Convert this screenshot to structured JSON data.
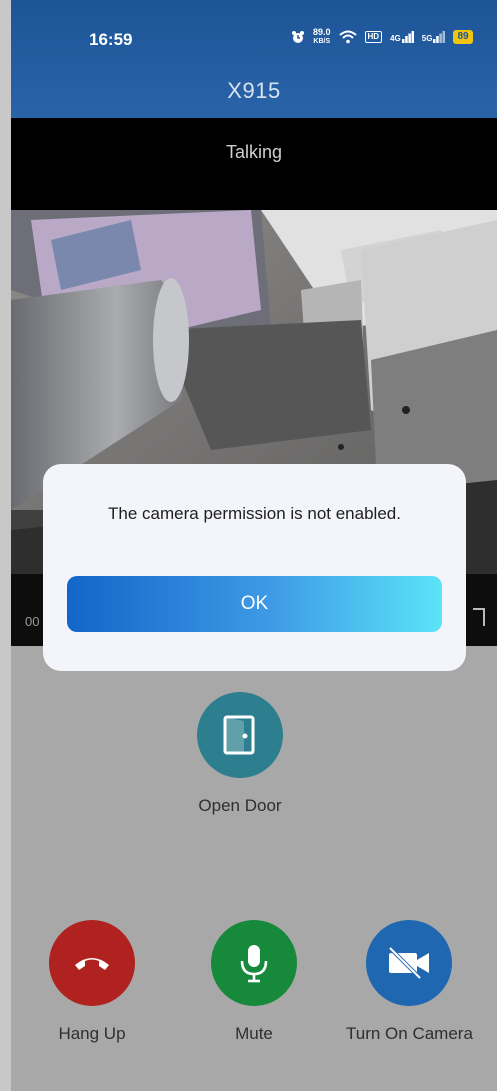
{
  "status_bar": {
    "time": "16:59",
    "speed_value": "89.0",
    "speed_unit": "KB/S",
    "hd_label": "HD",
    "net1": "4G",
    "net2": "5G",
    "battery": "89",
    "icons": [
      "alarm-icon",
      "wifi-icon",
      "signal-icon",
      "battery-icon"
    ]
  },
  "header": {
    "title": "X915"
  },
  "call": {
    "status": "Talking",
    "timer": "00"
  },
  "dialog": {
    "message": "The camera permission is not enabled.",
    "ok_label": "OK"
  },
  "controls": {
    "open_door": {
      "label": "Open Door",
      "color": "#2d7f8f",
      "icon": "door-icon"
    },
    "hang_up": {
      "label": "Hang Up",
      "color": "#b0221f",
      "icon": "phone-hangup-icon"
    },
    "mute": {
      "label": "Mute",
      "color": "#17893a",
      "icon": "microphone-icon"
    },
    "camera": {
      "label": "Turn On Camera",
      "color": "#1f67b0",
      "icon": "camera-off-icon"
    }
  }
}
